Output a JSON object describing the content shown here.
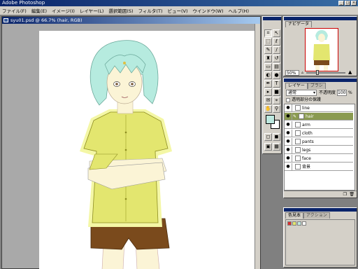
{
  "app": {
    "title": "Adobe Photoshop"
  },
  "menu": [
    "ファイル(F)",
    "編集(E)",
    "イメージ(I)",
    "レイヤー(L)",
    "選択範囲(S)",
    "フィルタ(T)",
    "ビュー(V)",
    "ウインドウ(W)",
    "ヘルプ(H)"
  ],
  "document": {
    "title": "syu01.psd @ 66.7% (hair, RGB)"
  },
  "navigator": {
    "tab": "ナビゲータ",
    "zoom": "50%"
  },
  "layers_panel": {
    "tab_layers": "レイヤー",
    "tab_brush": "ブラシ",
    "blend_mode": "通常",
    "opacity_label": "不透明度",
    "opacity_value": "100",
    "opacity_unit": "%",
    "preserve_label": "透明部分の保護",
    "layers": [
      {
        "name": "line",
        "selected": false,
        "has_brush": false
      },
      {
        "name": "hair",
        "selected": true,
        "has_brush": true
      },
      {
        "name": "arm",
        "selected": false,
        "has_brush": false
      },
      {
        "name": "cloth",
        "selected": false,
        "has_brush": false
      },
      {
        "name": "pants",
        "selected": false,
        "has_brush": false
      },
      {
        "name": "legs",
        "selected": false,
        "has_brush": false
      },
      {
        "name": "face",
        "selected": false,
        "has_brush": false
      },
      {
        "name": "背景",
        "selected": false,
        "has_brush": false
      }
    ]
  },
  "swatches_panel": {
    "tab_swatches": "色見本",
    "tab_actions": "アクション"
  },
  "colors": {
    "foreground": "#bde8df",
    "background": "#ffffff",
    "hair": "#b6ebdf",
    "shirt": "#e3e66f",
    "pants": "#7a4a1c",
    "skin": "#fbf4d6"
  }
}
